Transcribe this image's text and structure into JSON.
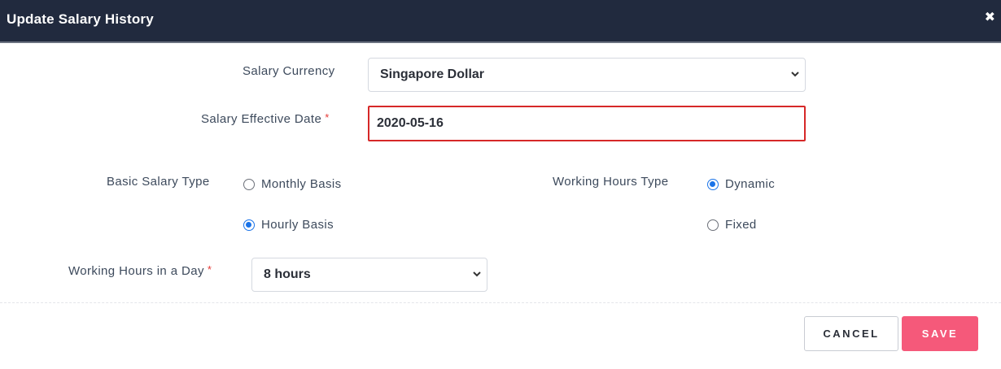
{
  "dialog": {
    "title": "Update Salary History",
    "close_glyph": "✖"
  },
  "form": {
    "salary_currency": {
      "label": "Salary Currency",
      "value": "Singapore Dollar"
    },
    "salary_effective_date": {
      "label": "Salary Effective Date",
      "required_mark": "*",
      "value": "2020-05-16"
    },
    "basic_salary_type": {
      "label": "Basic Salary Type",
      "options": [
        {
          "label": "Monthly Basis",
          "checked": false
        },
        {
          "label": "Hourly Basis",
          "checked": true
        }
      ]
    },
    "working_hours_type": {
      "label": "Working Hours Type",
      "options": [
        {
          "label": "Dynamic",
          "checked": true
        },
        {
          "label": "Fixed",
          "checked": false
        }
      ]
    },
    "working_hours_in_day": {
      "label": "Working Hours in a Day",
      "required_mark": "*",
      "value": "8 hours"
    }
  },
  "footer": {
    "cancel_label": "CANCEL",
    "save_label": "SAVE"
  },
  "colors": {
    "header_bg": "#212a3e",
    "error_border": "#d62828",
    "radio_accent": "#1a73e8",
    "save_bg": "#f5597a"
  },
  "icons": {
    "close": "close-icon",
    "select_arrow": "chevron-down-icon"
  }
}
